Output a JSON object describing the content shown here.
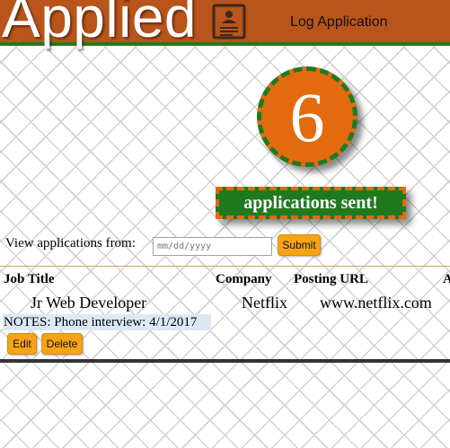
{
  "header": {
    "logo_text": "Applied",
    "nav_link": "Log Application"
  },
  "stats": {
    "count": "6",
    "banner": "applications sent!"
  },
  "filter": {
    "label": "View applications from:",
    "date_placeholder": "mm/dd/yyyy",
    "submit_label": "Submit"
  },
  "table": {
    "headers": [
      "Job Title",
      "Company",
      "Posting URL",
      "A"
    ],
    "rows": [
      {
        "job_title": "Jr Web Developer",
        "company": "Netflix",
        "posting_url": "www.netflix.com",
        "notes": "NOTES: Phone interview: 4/1/2017",
        "edit_label": "Edit",
        "delete_label": "Delete"
      }
    ]
  },
  "colors": {
    "header_bg": "#b9541a",
    "accent_orange": "#e36a0e",
    "accent_green": "#1f7a1f",
    "button": "#f6a416"
  },
  "icons": [
    "resume-icon"
  ]
}
